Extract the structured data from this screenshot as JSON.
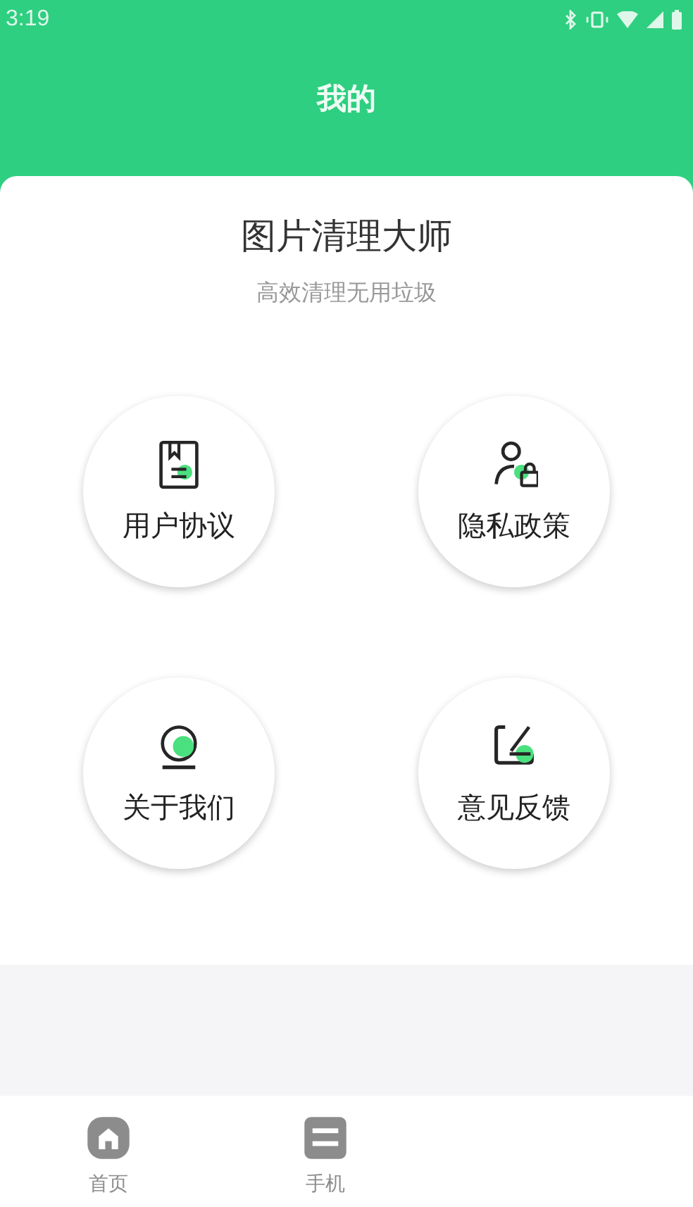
{
  "status_bar": {
    "time": "3:19"
  },
  "header": {
    "title": "我的"
  },
  "card": {
    "title": "图片清理大师",
    "subtitle": "高效清理无用垃圾"
  },
  "menu": [
    {
      "kind": "agreement",
      "label": "用户协议"
    },
    {
      "kind": "privacy",
      "label": "隐私政策"
    },
    {
      "kind": "about",
      "label": "关于我们"
    },
    {
      "kind": "feedback",
      "label": "意见反馈"
    }
  ],
  "tabs": [
    {
      "kind": "home",
      "label": "首页",
      "selected": false
    },
    {
      "kind": "phone",
      "label": "手机",
      "selected": false
    }
  ]
}
